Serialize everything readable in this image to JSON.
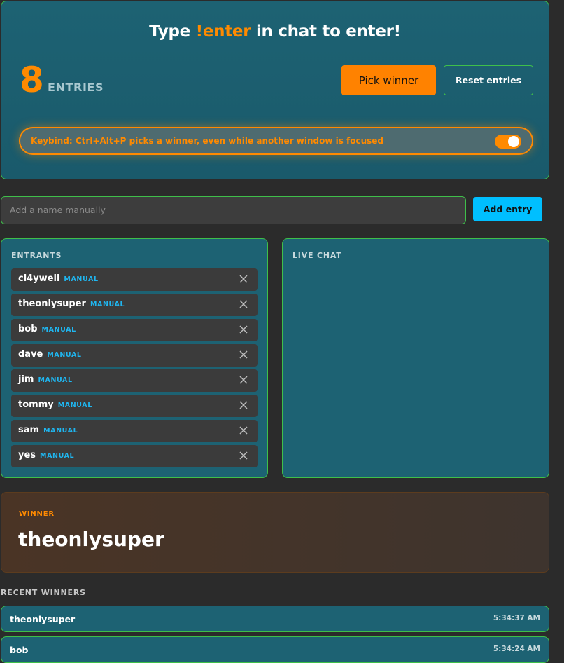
{
  "hero": {
    "title_prefix": "Type ",
    "title_command": "!enter",
    "title_suffix": " in chat to enter!",
    "entry_count": "8",
    "entry_label": "ENTRIES",
    "pick_winner_label": "Pick winner",
    "reset_entries_label": "Reset entries",
    "keybind_text": "Keybind: Ctrl+Alt+P picks a winner, even while another window is focused",
    "keybind_enabled": true
  },
  "manual": {
    "placeholder": "Add a name manually",
    "add_label": "Add entry"
  },
  "entrants": {
    "title": "ENTRANTS",
    "items": [
      {
        "name": "cl4ywell",
        "source": "MANUAL"
      },
      {
        "name": "theonlysuper",
        "source": "MANUAL"
      },
      {
        "name": "bob",
        "source": "MANUAL"
      },
      {
        "name": "dave",
        "source": "MANUAL"
      },
      {
        "name": "jim",
        "source": "MANUAL"
      },
      {
        "name": "tommy",
        "source": "MANUAL"
      },
      {
        "name": "sam",
        "source": "MANUAL"
      },
      {
        "name": "yes",
        "source": "MANUAL"
      }
    ]
  },
  "chat": {
    "title": "LIVE CHAT"
  },
  "winner": {
    "label": "WINNER",
    "name": "theonlysuper"
  },
  "recent": {
    "title": "RECENT WINNERS",
    "items": [
      {
        "name": "theonlysuper",
        "time": "5:34:37 AM"
      },
      {
        "name": "bob",
        "time": "5:34:24 AM"
      }
    ]
  },
  "colors": {
    "accent": "#ff8a00",
    "panel": "#1d6273",
    "border": "#3fbf4a",
    "badge": "#1fb6f0",
    "add_button": "#00bfff"
  },
  "icons": {
    "remove": "close-icon"
  }
}
